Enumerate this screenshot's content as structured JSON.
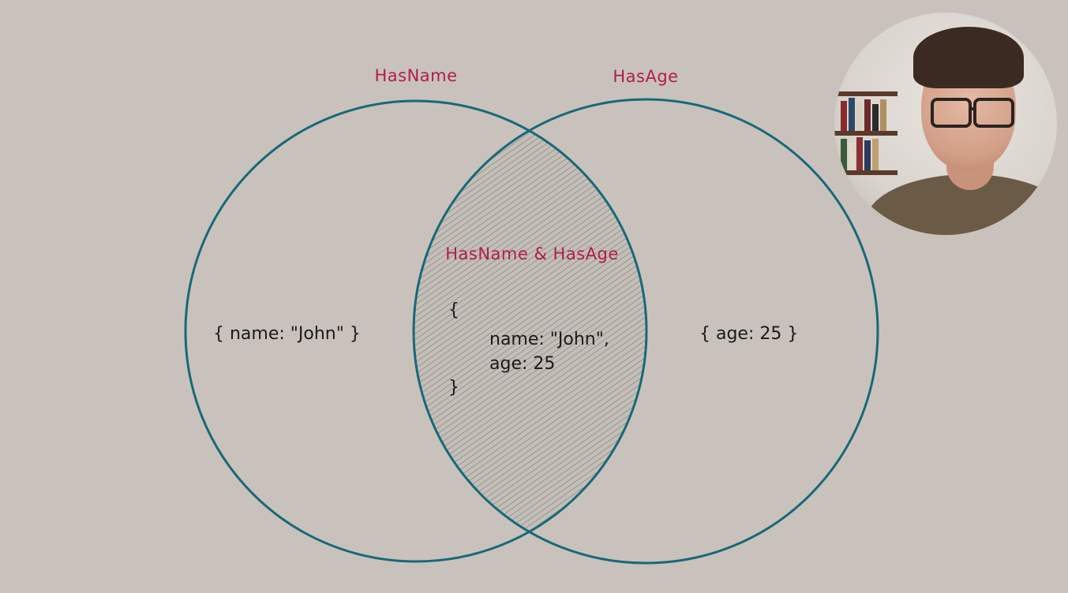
{
  "diagram": {
    "left_set_label": "HasName",
    "right_set_label": "HasAge",
    "intersection_label": "HasName & HasAge",
    "left_only_value": "{ name: \"John\" }",
    "right_only_value": "{ age: 25 }",
    "intersection_value": {
      "open_brace": "{",
      "line1": "name: \"John\",",
      "line2": "age: 25",
      "close_brace": "}"
    }
  },
  "colors": {
    "background": "#c9c2bc",
    "circle_stroke": "#17697a",
    "label_text": "#b01e4b",
    "code_text": "#1a1a1a",
    "intersection_hatch": "#8f8a86"
  },
  "webcam": {
    "icon": "presenter-webcam"
  }
}
